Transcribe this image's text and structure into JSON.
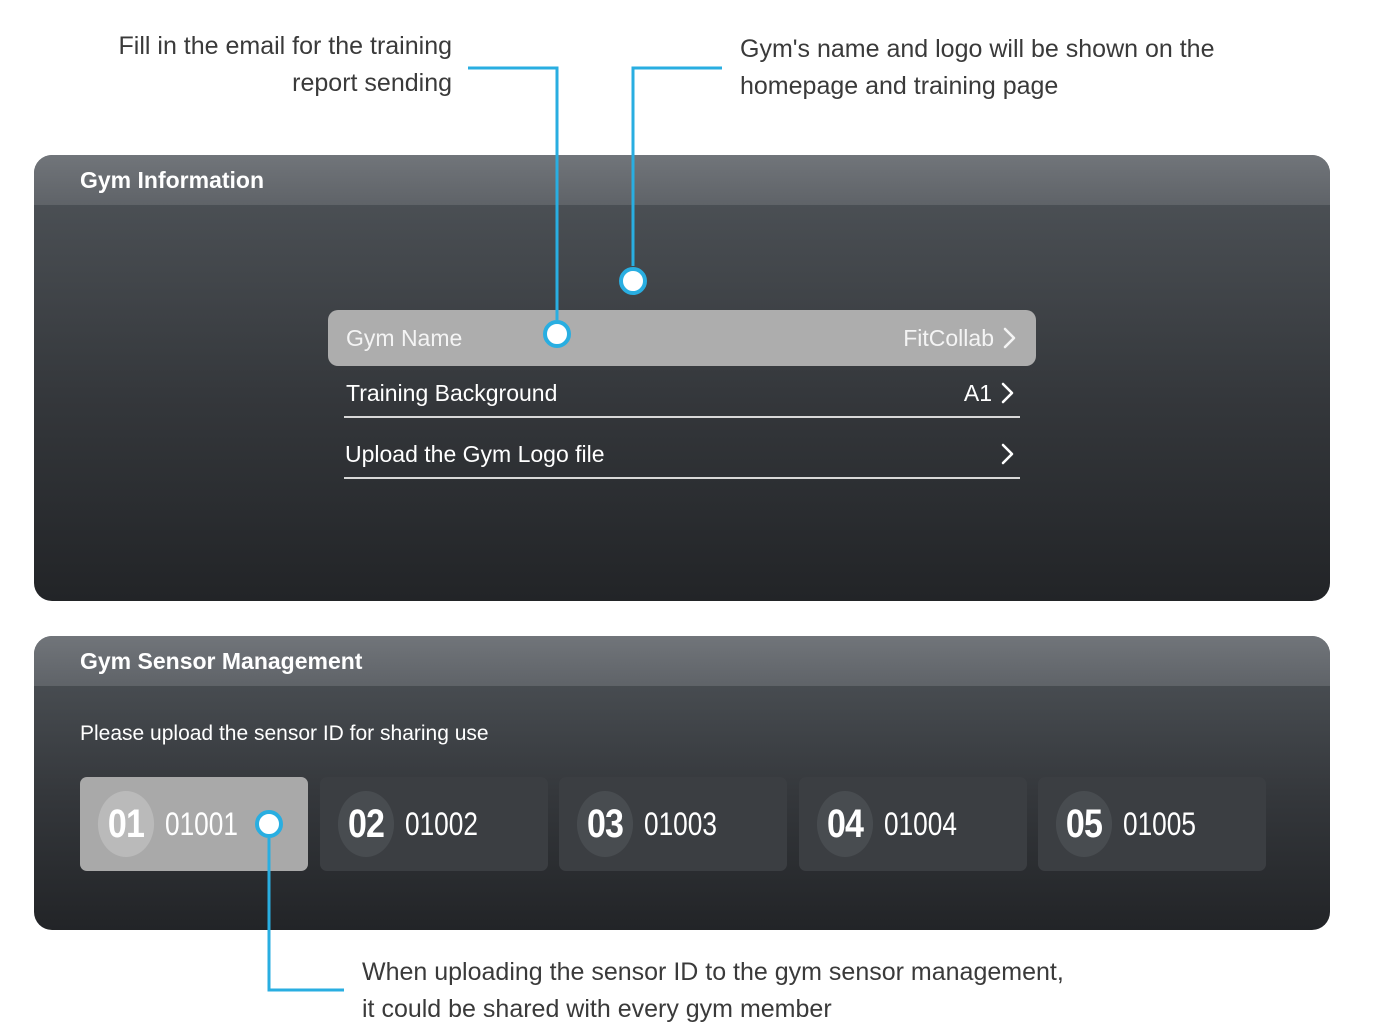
{
  "callouts": {
    "email_line1": "Fill in the email for the training",
    "email_line2": "report sending",
    "logo_line1": "Gym's name and logo will be shown on the",
    "logo_line2": "homepage and training page",
    "sensor_line1": "When uploading the sensor ID to the gym sensor management,",
    "sensor_line2": "it could be shared with every gym member"
  },
  "gym_info": {
    "title": "Gym Information",
    "rows": [
      {
        "label": "Gym Name",
        "value": "FitCollab"
      },
      {
        "label": "Training Background",
        "value": "A1"
      },
      {
        "label": "Upload the Gym Logo file",
        "value": ""
      }
    ]
  },
  "sensor_management": {
    "title": "Gym Sensor Management",
    "hint": "Please upload the sensor ID for sharing use",
    "sensors": [
      {
        "num": "01",
        "id": "01001"
      },
      {
        "num": "02",
        "id": "01002"
      },
      {
        "num": "03",
        "id": "01003"
      },
      {
        "num": "04",
        "id": "01004"
      },
      {
        "num": "05",
        "id": "01005"
      }
    ]
  },
  "colors": {
    "accent": "#29aee1",
    "panel_header": "#66696e",
    "selected_row": "#adadad"
  },
  "icons": {
    "row_arrow": "chevron-right-icon",
    "callout_marker": "callout-dot-icon"
  }
}
